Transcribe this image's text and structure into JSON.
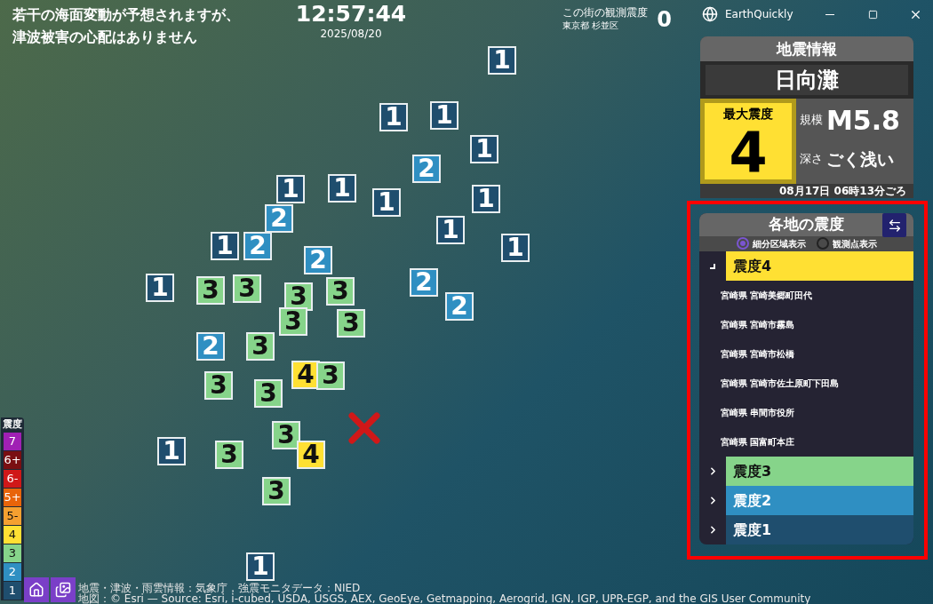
{
  "window": {
    "title": "EarthQuickly"
  },
  "banner": {
    "lines": [
      "若干の海面変動が予想されますが、",
      "津波被害の心配はありません"
    ]
  },
  "clock": {
    "time": "12:57:44",
    "date": "2025/08/20"
  },
  "local_intensity": {
    "label": "この街の観測震度",
    "location": "東京都 杉並区",
    "value": "0"
  },
  "quake_info": {
    "title": "地震情報",
    "region": "日向灘",
    "max_intensity_label": "最大震度",
    "max_intensity": "4",
    "magnitude_label": "規模",
    "magnitude": "M5.8",
    "depth_label": "深さ",
    "depth": "ごく浅い",
    "time": "08月17日 06時13分ごろ"
  },
  "regional": {
    "title": "各地の震度",
    "modes": [
      {
        "label": "細分区域表示",
        "selected": true
      },
      {
        "label": "観測点表示",
        "selected": false
      }
    ],
    "groups": [
      {
        "label": "震度4",
        "color": "#ffe033",
        "expanded": true,
        "stations": [
          "宮崎県 宮崎美郷町田代",
          "宮崎県 宮崎市霧島",
          "宮崎県 宮崎市松橋",
          "宮崎県 宮崎市佐土原町下田島",
          "宮崎県 串間市役所",
          "宮崎県 国富町本庄"
        ]
      },
      {
        "label": "震度3",
        "color": "#86d48a",
        "expanded": false
      },
      {
        "label": "震度2",
        "color": "#2f8fc2",
        "expanded": false
      },
      {
        "label": "震度1",
        "color": "#1f4e6e",
        "expanded": false
      }
    ]
  },
  "scale": {
    "title": "震度",
    "levels": [
      {
        "label": "7",
        "color": "#a020b4"
      },
      {
        "label": "6+",
        "color": "#7a0f12"
      },
      {
        "label": "6-",
        "color": "#d01818"
      },
      {
        "label": "5+",
        "color": "#e8640a"
      },
      {
        "label": "5-",
        "color": "#f5a030"
      },
      {
        "label": "4",
        "color": "#ffe033"
      },
      {
        "label": "3",
        "color": "#86d48a"
      },
      {
        "label": "2",
        "color": "#2f8fc2"
      },
      {
        "label": "1",
        "color": "#1f4e6e"
      }
    ]
  },
  "credits": [
    "地震・津波・雨雲情報：気象庁，強震モニタデータ：NIED",
    "地図：© Esri — Source: Esri, i-cubed, USDA, USGS, AEX, GeoEye, Getmapping, Aerogrid, IGN, IGP, UPR-EGP, and the GIS User Community"
  ],
  "markers": [
    {
      "label": "1",
      "color": "#1f4e6e"
    },
    {
      "label": "1",
      "color": "#1f4e6e"
    },
    {
      "label": "1",
      "color": "#1f4e6e"
    },
    {
      "label": "1",
      "color": "#1f4e6e"
    },
    {
      "label": "2",
      "color": "#2f8fc2"
    },
    {
      "label": "1",
      "color": "#1f4e6e"
    },
    {
      "label": "1",
      "color": "#1f4e6e"
    },
    {
      "label": "1",
      "color": "#1f4e6e"
    },
    {
      "label": "1",
      "color": "#1f4e6e"
    },
    {
      "label": "2",
      "color": "#2f8fc2"
    },
    {
      "label": "1",
      "color": "#1f4e6e"
    },
    {
      "label": "2",
      "color": "#2f8fc2"
    },
    {
      "label": "1",
      "color": "#1f4e6e"
    },
    {
      "label": "1",
      "color": "#1f4e6e"
    },
    {
      "label": "2",
      "color": "#2f8fc2"
    },
    {
      "label": "1",
      "color": "#1f4e6e"
    },
    {
      "label": "3",
      "color": "#86d48a"
    },
    {
      "label": "3",
      "color": "#86d48a"
    },
    {
      "label": "3",
      "color": "#86d48a"
    },
    {
      "label": "3",
      "color": "#86d48a"
    },
    {
      "label": "2",
      "color": "#2f8fc2"
    },
    {
      "label": "2",
      "color": "#2f8fc2"
    },
    {
      "label": "3",
      "color": "#86d48a"
    },
    {
      "label": "3",
      "color": "#86d48a"
    },
    {
      "label": "2",
      "color": "#2f8fc2"
    },
    {
      "label": "3",
      "color": "#86d48a"
    },
    {
      "label": "4",
      "color": "#ffe033"
    },
    {
      "label": "3",
      "color": "#86d48a"
    },
    {
      "label": "3",
      "color": "#86d48a"
    },
    {
      "label": "3",
      "color": "#86d48a"
    },
    {
      "label": "3",
      "color": "#86d48a"
    },
    {
      "label": "1",
      "color": "#1f4e6e"
    },
    {
      "label": "3",
      "color": "#86d48a"
    },
    {
      "label": "4",
      "color": "#ffe033"
    },
    {
      "label": "3",
      "color": "#86d48a"
    },
    {
      "label": "1",
      "color": "#1f4e6e"
    }
  ]
}
